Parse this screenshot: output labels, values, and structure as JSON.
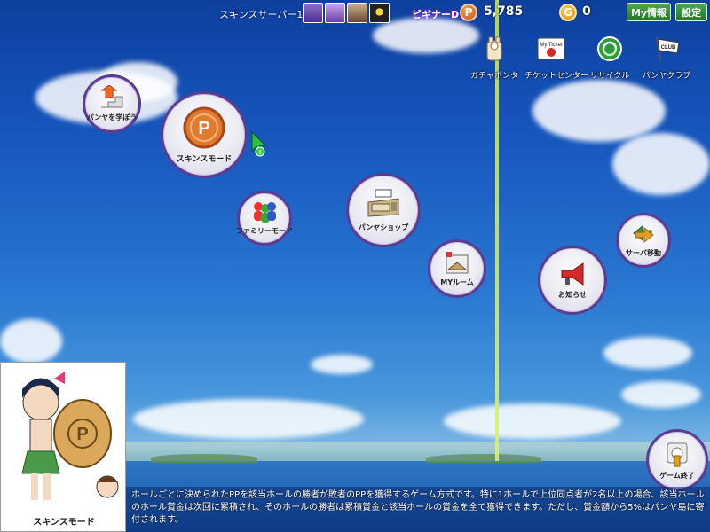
{
  "topbar": {
    "server_name": "スキンスサーバー1",
    "rank": "ビギナーD",
    "p_points": "5,785",
    "g_points": "0",
    "my_info_label": "My情報",
    "settings_label": "設定"
  },
  "quick_menu": [
    {
      "label": "ガチャポンタ",
      "icon": "gacha-icon"
    },
    {
      "label": "チケットセンター",
      "icon": "ticket-icon",
      "icon_text": "My Ticket"
    },
    {
      "label": "リサイクル",
      "icon": "recycle-icon"
    },
    {
      "label": "パンヤクラブ",
      "icon": "club-flag-icon",
      "icon_text": "CLUB"
    }
  ],
  "menu": {
    "learn": "パンヤを学ぼう",
    "skins_mode": "スキンスモード",
    "family_mode": "ファミリーモード",
    "shop": "パンヤショップ",
    "my_room": "MYルーム",
    "notice": "お知らせ",
    "server_move": "サーバ移動",
    "quit": "ゲーム終了"
  },
  "info": {
    "card_title": "スキンスモード",
    "description": "ホールごとに決められたPPを該当ホールの勝者が敗者のPPを獲得するゲーム方式です。特に1ホールで上位同点者が2名以上の場合、該当ホールのホール賞金は次回に累積され、そのホールの勝者は累積賞金と該当ホールの賞金を全て獲得できます。ただし、賞金額から5%はパンヤ島に寄付されます。"
  },
  "colors": {
    "circle_border": "#5a3d8f",
    "button_green": "#237a23",
    "beam": "#c8e64a"
  }
}
